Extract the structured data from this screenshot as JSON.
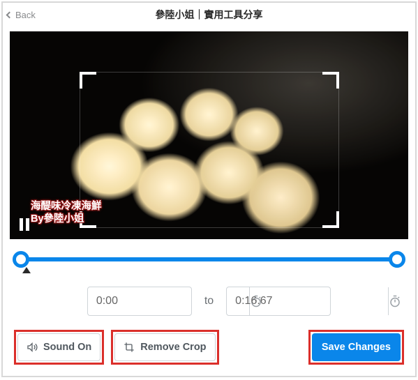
{
  "header": {
    "back_label": "Back",
    "title": "參陸小姐｜實用工具分享"
  },
  "video": {
    "watermark": "海醍味冷凍海鮮\nBy參陸小姐"
  },
  "trim": {
    "start_value": "0:00",
    "end_value": "0:16.67",
    "separator_label": "to"
  },
  "controls": {
    "sound_label": "Sound On",
    "remove_crop_label": "Remove Crop",
    "save_label": "Save Changes"
  }
}
